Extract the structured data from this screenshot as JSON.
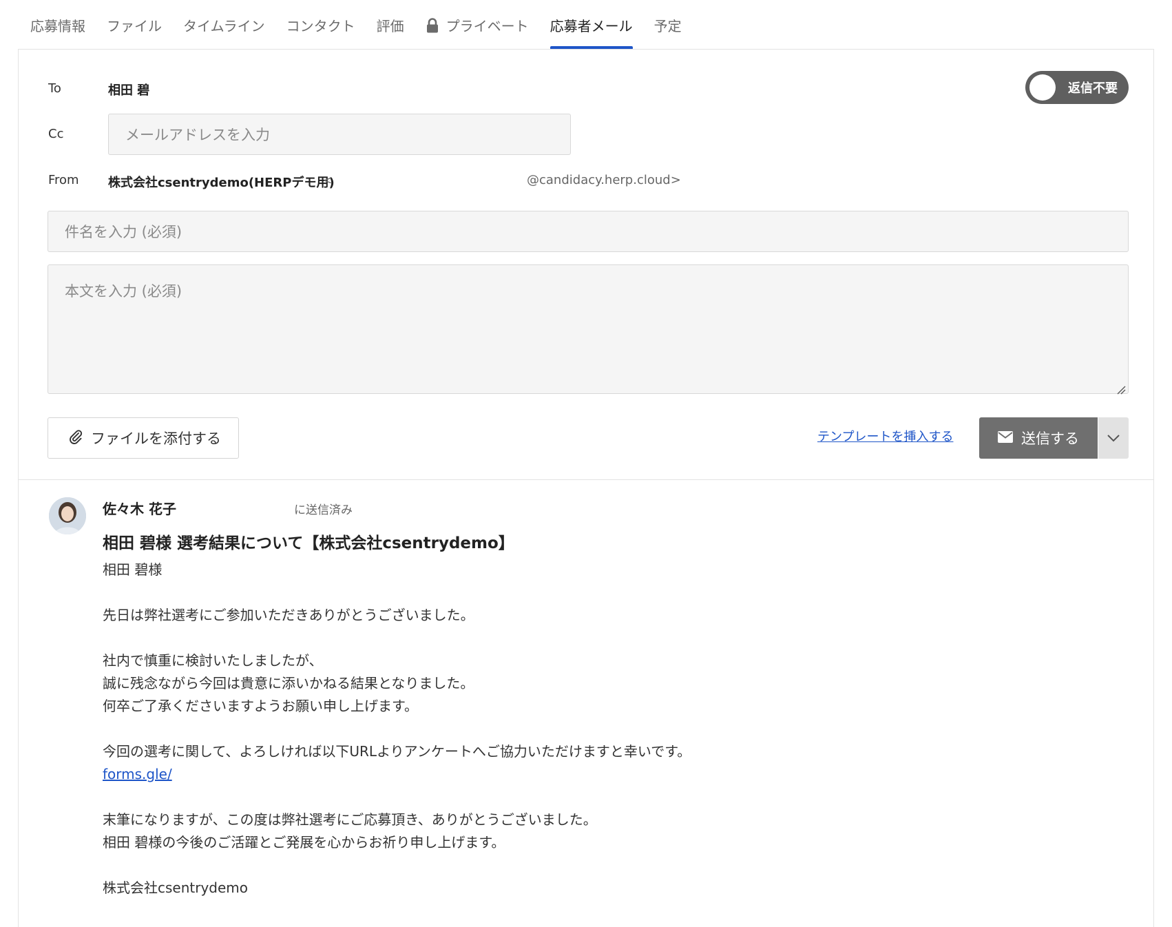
{
  "tabs": [
    {
      "label": "応募情報"
    },
    {
      "label": "ファイル"
    },
    {
      "label": "タイムライン"
    },
    {
      "label": "コンタクト"
    },
    {
      "label": "評価"
    },
    {
      "label": "プライベート",
      "icon": "lock-icon"
    },
    {
      "label": "応募者メール",
      "active": true
    },
    {
      "label": "予定"
    }
  ],
  "compose": {
    "to_label": "To",
    "to_value": "相田 碧",
    "no_reply_toggle": "返信不要",
    "cc_label": "Cc",
    "cc_placeholder": "メールアドレスを入力",
    "from_label": "From",
    "from_name": "株式会社csentrydemo(HERPデモ用)",
    "from_bracket_open": "<",
    "from_email_domain": "@candidacy.herp.cloud>",
    "subject_placeholder": "件名を入力 (必須)",
    "body_placeholder": "本文を入力 (必須)",
    "attach_label": "ファイルを添付する",
    "template_link": "テンプレートを挿入する",
    "send_label": "送信する"
  },
  "message": {
    "sender": "佐々木 花子",
    "status": "に送信済み",
    "subject": "相田 碧様 選考結果について【株式会社csentrydemo】",
    "lines": [
      "相田 碧様",
      "",
      "先日は弊社選考にご参加いただきありがとうございました。",
      "",
      "社内で慎重に検討いたしましたが、",
      "誠に残念ながら今回は貴意に添いかねる結果となりました。",
      "何卒ご了承くださいますようお願い申し上げます。",
      "",
      "今回の選考に関して、よろしければ以下URLよりアンケートへご協力いただけますと幸いです。"
    ],
    "link": "forms.gle/",
    "lines_after": [
      "",
      "末筆になりますが、この度は弊社選考にご応募頂き、ありがとうございました。",
      "相田 碧様の今後のご活躍とご発展を心からお祈り申し上げます。",
      "",
      "株式会社csentrydemo"
    ]
  },
  "colors": {
    "accent": "#1e55c8",
    "send_button": "#6f6f6f",
    "toggle": "#5f5f5f"
  }
}
